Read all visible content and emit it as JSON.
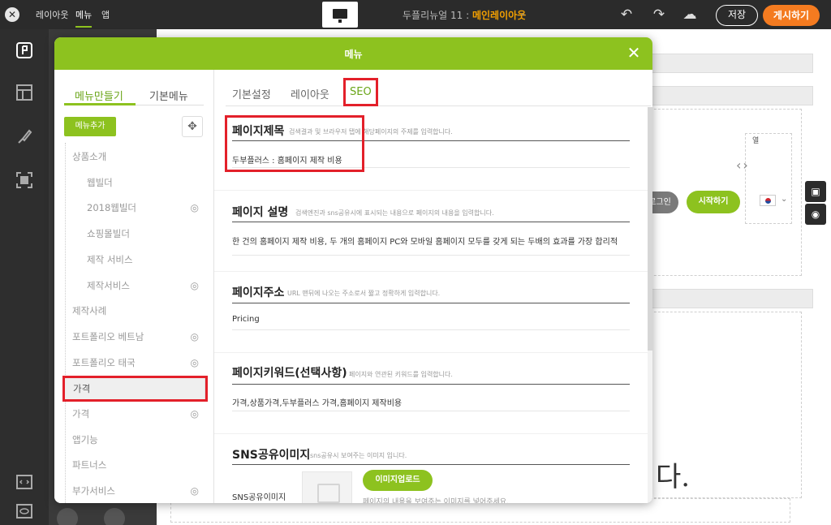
{
  "topbar": {
    "tabs": [
      "레이아웃",
      "메뉴",
      "앱"
    ],
    "active_tab": "메뉴",
    "title_prefix": "두플리뉴얼 11 : ",
    "title_page": "메인레이아웃",
    "save_label": "저장",
    "publish_label": "게시하기"
  },
  "background": {
    "login_label": "로그인",
    "start_label": "시작하기",
    "column_label": "열",
    "big_text": "다."
  },
  "modal": {
    "title": "메뉴",
    "left_tabs": [
      "메뉴만들기",
      "기본메뉴"
    ],
    "add_menu_label": "메뉴추가",
    "menu_items": [
      {
        "label": "상품소개",
        "indent": false,
        "hidden_icon": false
      },
      {
        "label": "웹빌더",
        "indent": true,
        "hidden_icon": false
      },
      {
        "label": "2018웹빌더",
        "indent": true,
        "hidden_icon": true
      },
      {
        "label": "쇼핑몰빌더",
        "indent": true,
        "hidden_icon": false
      },
      {
        "label": "제작 서비스",
        "indent": true,
        "hidden_icon": false
      },
      {
        "label": "제작서비스",
        "indent": true,
        "hidden_icon": true
      },
      {
        "label": "제작사례",
        "indent": false,
        "hidden_icon": false
      },
      {
        "label": "포트폴리오 베트남",
        "indent": false,
        "hidden_icon": true
      },
      {
        "label": "포트폴리오 태국",
        "indent": false,
        "hidden_icon": true
      },
      {
        "label": "가격",
        "indent": false,
        "hidden_icon": false,
        "selected": true
      },
      {
        "label": "가격",
        "indent": false,
        "hidden_icon": true
      },
      {
        "label": "앱기능",
        "indent": false,
        "hidden_icon": false
      },
      {
        "label": "파트너스",
        "indent": false,
        "hidden_icon": false
      },
      {
        "label": "부가서비스",
        "indent": false,
        "hidden_icon": true
      }
    ],
    "content_tabs": [
      "기본설정",
      "레이아웃",
      "SEO"
    ],
    "active_content_tab": "SEO",
    "seo": {
      "page_title": {
        "label": "페이지제목",
        "desc": "검색결과 및 브라우저 탭에 해당페이지의 주제를 입력합니다.",
        "value": "두부플러스 : 홈페이지 제작 비용"
      },
      "page_desc": {
        "label": "페이지 설명",
        "desc": "검색엔진과 sns공유시에 표시되는 내용으로 페이지의 내용을 입력합니다.",
        "value": "한 건의 홈페이지 제작 비용, 두 개의 홈페이지 PC와 모바일 홈페이지 모두를 갖게 되는 두배의 효과를 가장 합리적"
      },
      "page_url": {
        "label": "페이지주소",
        "desc": "URL 맨뒤에 나오는 주소로서 짧고 정확하게 입력합니다.",
        "value": "Pricing"
      },
      "keywords": {
        "label": "페이지키워드(선택사항)",
        "desc": "페이지와 연관된 키워드를 입력합니다.",
        "value": "가격,상품가격,두부플러스 가격,홈페이지 제작비용"
      },
      "sns_image": {
        "label": "SNS공유이미지",
        "desc": "sns공유시 보여주는 이미지 입니다.",
        "field_label": "SNS공유이미지",
        "upload_label": "이미지업로드",
        "note": "페이지의 내용을 보여주는 이미지를 넣어주세요."
      }
    }
  },
  "colors": {
    "accent": "#8dc21f",
    "highlight": "#e3202a",
    "publish": "#f47b20"
  }
}
